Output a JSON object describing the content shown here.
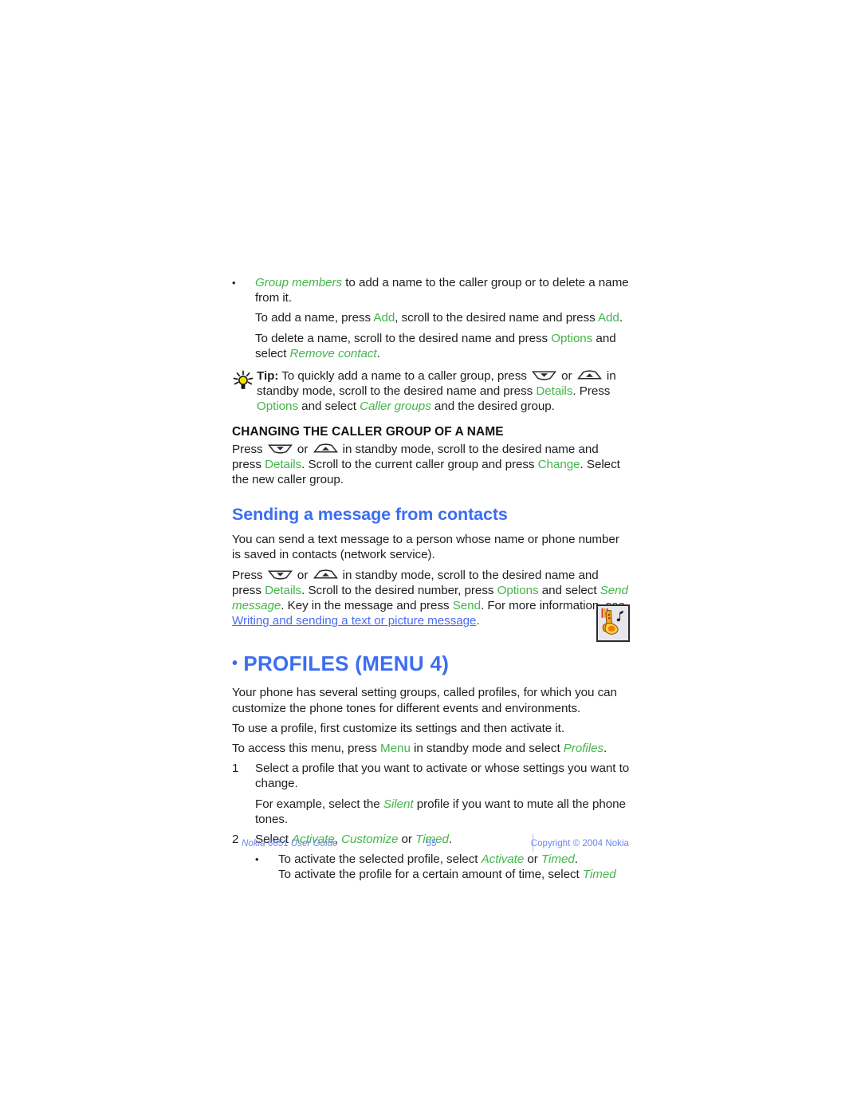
{
  "document": {
    "page_number": "55",
    "footer_left_brand": "Nokia",
    "footer_left_model": "6651",
    "footer_left_title": "User Guide",
    "footer_right": "Copyright © 2004 Nokia"
  },
  "colors": {
    "softkey_green": "#43b649",
    "heading_blue": "#3b6ef0",
    "link_blue": "#4a6ef0",
    "footer_blue": "#6b86f5",
    "body_text": "#1f1f1f",
    "bulb_yellow": "#f5e000"
  },
  "blocks": {
    "group_members_bullet": {
      "marker": "•",
      "term": "Group members",
      "rest": " to add a name to the caller group or to delete a name from it."
    },
    "add_name": {
      "p1": "To add a name, press ",
      "k1": "Add",
      "p2": ", scroll to the desired name and press ",
      "k2": "Add",
      "p3": "."
    },
    "delete_name": {
      "p1": "To delete a name, scroll to the desired name and press ",
      "k1": "Options",
      "p2": " and select ",
      "i1": "Remove contact",
      "p3": "."
    },
    "tip": {
      "icon": "lightbulb-icon",
      "label": "Tip:",
      "p1": " To quickly add a name to a caller group, press ",
      "key_down": "scroll-down-key",
      "p2": " or ",
      "key_up": "scroll-up-key",
      "p3": " in standby mode, scroll to the desired name and press ",
      "k1": "Details",
      "p4": ". Press ",
      "k2": "Options",
      "p5": " and select ",
      "i1": "Caller groups",
      "p6": " and the desired group."
    },
    "changing_caller_group": {
      "heading": "CHANGING THE CALLER GROUP OF A NAME",
      "p1": "Press ",
      "key_down": "scroll-down-key",
      "p2": " or ",
      "key_up": "scroll-up-key",
      "p3": " in standby mode, scroll to the desired name and press ",
      "k1": "Details",
      "p4": ". Scroll to the current caller group and press ",
      "k2": "Change",
      "p5": ". Select the new caller group."
    },
    "sending_message": {
      "heading": "Sending a message from contacts",
      "intro": "You can send a text message to a person whose name or phone number is saved in contacts (network service).",
      "steps_p1": "Press ",
      "key_down": "scroll-down-key",
      "steps_p2": " or ",
      "key_up": "scroll-up-key",
      "steps_p3": " in standby mode, scroll to the desired name and press ",
      "k1": "Details",
      "steps_p4": ". Scroll to the desired number, press ",
      "k2": "Options",
      "steps_p5": " and select ",
      "i1": "Send message",
      "steps_p6": ". Key in the message and press ",
      "k3": "Send",
      "steps_p7": ". For more information, see ",
      "link": "Writing and sending a text or picture message",
      "steps_p8": "."
    },
    "profiles": {
      "bullet": "•",
      "heading": "PROFILES (MENU 4)",
      "icon": "saxophone-music-note-icon",
      "intro": "Your phone has several setting groups, called profiles, for which you can customize the phone tones for different events and environments.",
      "use": "To use a profile, first customize its settings and then activate it.",
      "access_p1": "To access this menu, press ",
      "access_k1": "Menu",
      "access_p2": " in standby mode and select ",
      "access_i1": "Profiles",
      "access_p3": ".",
      "step1_num": "1",
      "step1": "Select a profile that you want to activate or whose settings you want to change.",
      "step1_example_p1": "For example, select the ",
      "step1_example_i1": "Silent",
      "step1_example_p2": " profile if you want to mute all the phone tones.",
      "step2_num": "2",
      "step2_p1": "Select ",
      "step2_i1": "Activate",
      "step2_p2": ", ",
      "step2_i2": "Customize",
      "step2_p3": " or ",
      "step2_i3": "Timed",
      "step2_p4": ".",
      "sub_marker": "•",
      "sub1_p1": "To activate the selected profile, select ",
      "sub1_i1": "Activate",
      "sub1_p2": " or ",
      "sub1_i2": "Timed",
      "sub1_p3": ".",
      "sub2_p1": "To activate the profile for a certain amount of time, select ",
      "sub2_i1": "Timed"
    }
  }
}
